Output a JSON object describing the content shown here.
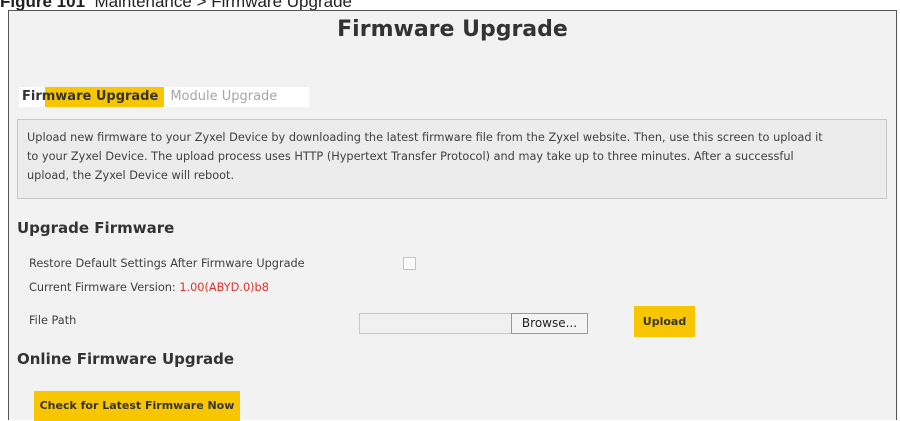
{
  "figure_caption": {
    "number": "Figure 101",
    "text": "Maintenance > Firmware Upgrade"
  },
  "page": {
    "title": "Firmware Upgrade"
  },
  "tabs": [
    {
      "label": "Firmware Upgrade",
      "active": true
    },
    {
      "label": "Module Upgrade",
      "active": false
    }
  ],
  "info": {
    "line1": "Upload new firmware to your Zyxel Device by downloading the latest firmware file from the Zyxel website. Then, use this screen to upload it",
    "line2": "to your Zyxel Device. The upload process uses HTTP (Hypertext Transfer Protocol) and may take up to three minutes. After a successful",
    "line3": "upload, the Zyxel Device will reboot."
  },
  "upgrade_firmware": {
    "title": "Upgrade Firmware",
    "restore_label": "Restore Default Settings After Firmware Upgrade",
    "restore_checked": false,
    "current_version_label": "Current Firmware Version: ",
    "current_version_value": "1.00(ABYD.0)b8",
    "file_path_label": "File Path",
    "file_path_value": "",
    "browse_label": "Browse...",
    "upload_label": "Upload"
  },
  "online_upgrade": {
    "title": "Online Firmware Upgrade",
    "check_label": "Check for Latest Firmware Now"
  },
  "colors": {
    "accent": "#f7c600",
    "version_text": "#e0322d",
    "panel_bg": "#f2f2f2"
  }
}
